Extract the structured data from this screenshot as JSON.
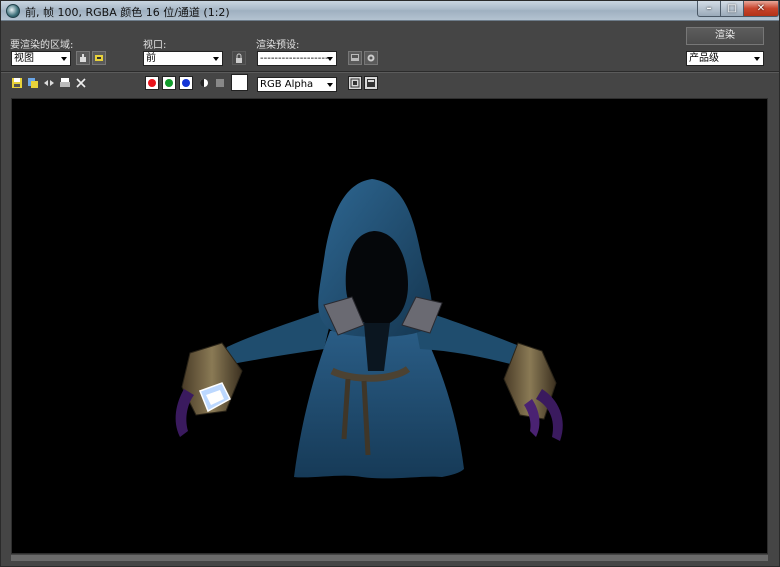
{
  "window": {
    "title": "前, 帧 100, RGBA 颜色 16 位/通道 (1:2)"
  },
  "toolbar": {
    "area_label": "要渲染的区域:",
    "area_value": "视图",
    "viewport_label": "视口:",
    "viewport_value": "前",
    "preset_label": "渲染预设:",
    "preset_value": "--------------------",
    "render_button": "渲染",
    "quality_value": "产品级"
  },
  "channel_bar": {
    "channel_value": "RGB Alpha"
  },
  "colors": {
    "red_channel": "#e8141c",
    "green_channel": "#119c2b",
    "blue_channel": "#1435d6",
    "cloak": "#1f4d6e",
    "crystal": "#bcd8ff"
  }
}
